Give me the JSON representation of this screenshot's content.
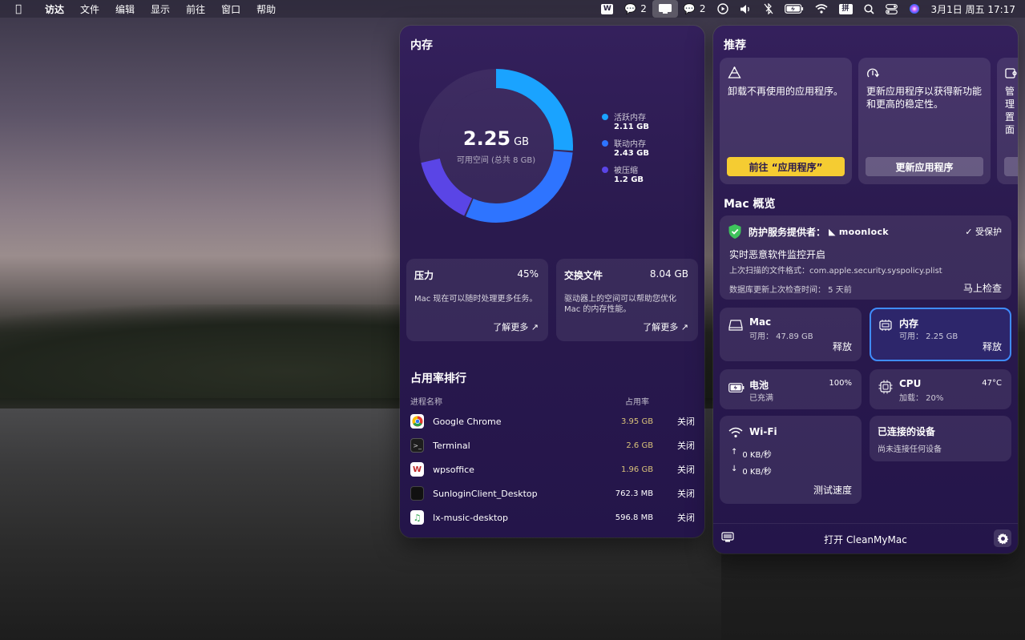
{
  "menubar": {
    "app": "访达",
    "menus": [
      "文件",
      "编辑",
      "显示",
      "前往",
      "窗口",
      "帮助"
    ],
    "wechat_count_1": "2",
    "wechat_count_2": "2",
    "input_method": "拼",
    "datetime": "3月1日 周五  17:17"
  },
  "memory": {
    "title": "内存",
    "value": "2.25",
    "unit": "GB",
    "caption": "可用空间 (总共 8 GB)",
    "legend": [
      {
        "label": "活跃内存",
        "value": "2.11 GB",
        "color": "#1aa3ff"
      },
      {
        "label": "联动内存",
        "value": "2.43 GB",
        "color": "#2e74ff"
      },
      {
        "label": "被压缩",
        "value": "1.2 GB",
        "color": "#5a45e6"
      }
    ],
    "donut_fractions": [
      0.264,
      0.304,
      0.15
    ],
    "pressure": {
      "title": "压力",
      "value": "45%",
      "text": "Mac 现在可以随时处理更多任务。",
      "link": "了解更多 ↗"
    },
    "swap": {
      "title": "交换文件",
      "value": "8.04 GB",
      "text": "驱动器上的空间可以帮助您优化 Mac 的内存性能。",
      "link": "了解更多 ↗"
    },
    "ranking": {
      "title": "占用率排行",
      "col_name": "进程名称",
      "col_usage": "占用率",
      "rows": [
        {
          "name": "Google Chrome",
          "value": "3.95 GB",
          "action": "关闭"
        },
        {
          "name": "Terminal",
          "value": "2.6 GB",
          "action": "关闭"
        },
        {
          "name": "wpsoffice",
          "value": "1.96 GB",
          "action": "关闭"
        },
        {
          "name": "SunloginClient_Desktop",
          "value": "762.3 MB",
          "action": "关闭"
        },
        {
          "name": "lx-music-desktop",
          "value": "596.8 MB",
          "action": "关闭"
        }
      ]
    }
  },
  "recommend": {
    "title": "推荐",
    "cards": [
      {
        "text": "卸载不再使用的应用程序。",
        "button": "前往 “应用程序”"
      },
      {
        "text": "更新应用程序以获得新功能和更高的稳定性。",
        "button": "更新应用程序"
      },
      {
        "text": "管理置面",
        "button": ""
      }
    ]
  },
  "overview": {
    "title": "Mac 概览",
    "protection": {
      "provider_label": "防护服务提供者：",
      "brand": "moonlock",
      "status": "受保护",
      "headline": "实时恶意软件监控开启",
      "last_scan": "上次扫描的文件格式：com.apple.security.syspolicy.plist",
      "db_update": "数据库更新上次检查时间：  5 天前",
      "check_now": "马上检查"
    },
    "mac": {
      "title": "Mac",
      "sub": "可用：  47.89 GB",
      "action": "释放"
    },
    "memory": {
      "title": "内存",
      "sub": "可用：  2.25 GB",
      "action": "释放"
    },
    "battery": {
      "title": "电池",
      "sub": "已充满",
      "value": "100%"
    },
    "cpu": {
      "title": "CPU",
      "sub": "加载：  20%",
      "value": "47°C"
    },
    "wifi": {
      "title": "Wi-Fi",
      "up": "0 KB/秒",
      "down": "0 KB/秒",
      "action": "测试速度"
    },
    "devices": {
      "title": "已连接的设备",
      "sub": "尚未连接任何设备"
    }
  },
  "footer": {
    "open": "打开 CleanMyMac"
  }
}
